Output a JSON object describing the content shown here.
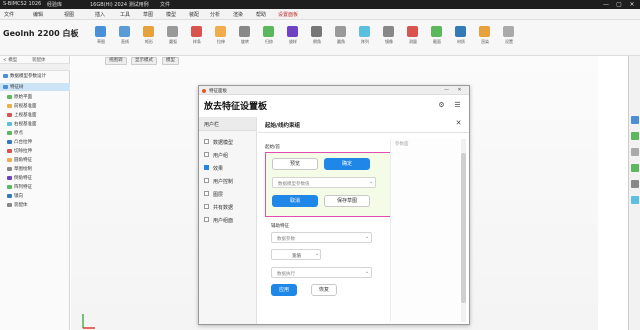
{
  "window": {
    "title_left": "S-BIMCS2 1026",
    "title_tab1": "经验库",
    "title_center": "16GB(Hi) 2024 测试用例",
    "title_right": "文件",
    "controls": [
      "—",
      "▢",
      "✕"
    ]
  },
  "menu": {
    "items": [
      "文件",
      "编辑",
      "视图",
      "插入",
      "工具",
      "草图",
      "模型",
      "装配",
      "分析",
      "渲染",
      "帮助",
      "设置面板"
    ],
    "active_index": 11
  },
  "toolbar": {
    "app_title": "Geolnh 2200 白板",
    "tools": [
      {
        "label": "草图",
        "icon": "sketch-icon",
        "color": "#4a90d9"
      },
      {
        "label": "直线",
        "icon": "line-icon",
        "color": "#5b9bd5"
      },
      {
        "label": "矩形",
        "icon": "rectangle-icon",
        "color": "#e6a23c"
      },
      {
        "label": "圆弧",
        "icon": "arc-icon",
        "color": "#999999"
      },
      {
        "label": "样条",
        "icon": "spline-icon",
        "color": "#d9534f"
      },
      {
        "label": "拉伸",
        "icon": "extrude-icon",
        "color": "#f0ad4e"
      },
      {
        "label": "旋转",
        "icon": "revolve-icon",
        "color": "#888888"
      },
      {
        "label": "扫掠",
        "icon": "sweep-icon",
        "color": "#5cb85c"
      },
      {
        "label": "放样",
        "icon": "loft-icon",
        "color": "#6f42c1"
      },
      {
        "label": "倒角",
        "icon": "chamfer-icon",
        "color": "#777777"
      },
      {
        "label": "圆角",
        "icon": "fillet-icon",
        "color": "#999999"
      },
      {
        "label": "阵列",
        "icon": "pattern-icon",
        "color": "#5bc0de"
      },
      {
        "label": "镜像",
        "icon": "mirror-icon",
        "color": "#888888"
      },
      {
        "label": "测量",
        "icon": "measure-icon",
        "color": "#d9534f"
      },
      {
        "label": "截面",
        "icon": "section-icon",
        "color": "#5cb85c"
      },
      {
        "label": "材质",
        "icon": "material-icon",
        "color": "#337ab7"
      },
      {
        "label": "渲染",
        "icon": "render-icon",
        "color": "#e6a23c"
      },
      {
        "label": "设置",
        "icon": "settings-icon",
        "color": "#aaaaaa"
      }
    ]
  },
  "left_panel": {
    "tabs": [
      "< 模型",
      "装配体"
    ],
    "items": [
      {
        "label": "数据模型参数设计",
        "icon_color": "#4a90d9",
        "selected": false
      },
      {
        "label": "特征树",
        "icon_color": "#4a90d9",
        "selected": true
      },
      {
        "label": "原始平面",
        "icon_color": "#5cb85c",
        "selected": false
      },
      {
        "label": "前视基准面",
        "icon_color": "#f0ad4e",
        "selected": false
      },
      {
        "label": "上视基准面",
        "icon_color": "#d9534f",
        "selected": false
      },
      {
        "label": "右视基准面",
        "icon_color": "#5bc0de",
        "selected": false
      },
      {
        "label": "原点",
        "icon_color": "#5cb85c",
        "selected": false
      },
      {
        "label": "凸台拉伸",
        "icon_color": "#337ab7",
        "selected": false
      },
      {
        "label": "切除拉伸",
        "icon_color": "#d9534f",
        "selected": false
      },
      {
        "label": "圆角特征",
        "icon_color": "#f0ad4e",
        "selected": false
      },
      {
        "label": "草图绘制",
        "icon_color": "#888888",
        "selected": false
      },
      {
        "label": "倒角特征",
        "icon_color": "#6f42c1",
        "selected": false
      },
      {
        "label": "阵列特征",
        "icon_color": "#5cb85c",
        "selected": false
      },
      {
        "label": "镜向",
        "icon_color": "#337ab7",
        "selected": false
      },
      {
        "label": "装配体",
        "icon_color": "#888888",
        "selected": false
      }
    ]
  },
  "viewport": {
    "view_buttons": [
      "视图调",
      "显示模式",
      "模型"
    ]
  },
  "dialog": {
    "window_title": "特征面板",
    "heading": "放去特征设置板",
    "header_icons": [
      "settings-icon",
      "menu-icon"
    ],
    "sidebar": {
      "header": "用户栏",
      "items": [
        {
          "label": "数据模型",
          "active": false
        },
        {
          "label": "用户组",
          "active": false
        },
        {
          "label": "效果",
          "active": true
        },
        {
          "label": "用户控制",
          "active": false
        },
        {
          "label": "图层",
          "active": false
        },
        {
          "label": "共有数据",
          "active": false
        },
        {
          "label": "用户组面",
          "active": false
        }
      ]
    },
    "content": {
      "title": "起始/线约束组",
      "section1_label": "起始/首",
      "btn_outline_1": "预览",
      "btn_primary_1": "确定",
      "select_1": "数据模型参数值",
      "btn_primary_2": "取消",
      "btn_outline_2": "保存草图",
      "section2_label": "辅助特征",
      "select_2": "数据参数",
      "field_text": "宽值",
      "select_3": "数据执行",
      "btn_primary_3": "应用",
      "btn_outline_3": "恢复",
      "right_label": "参数面"
    }
  }
}
